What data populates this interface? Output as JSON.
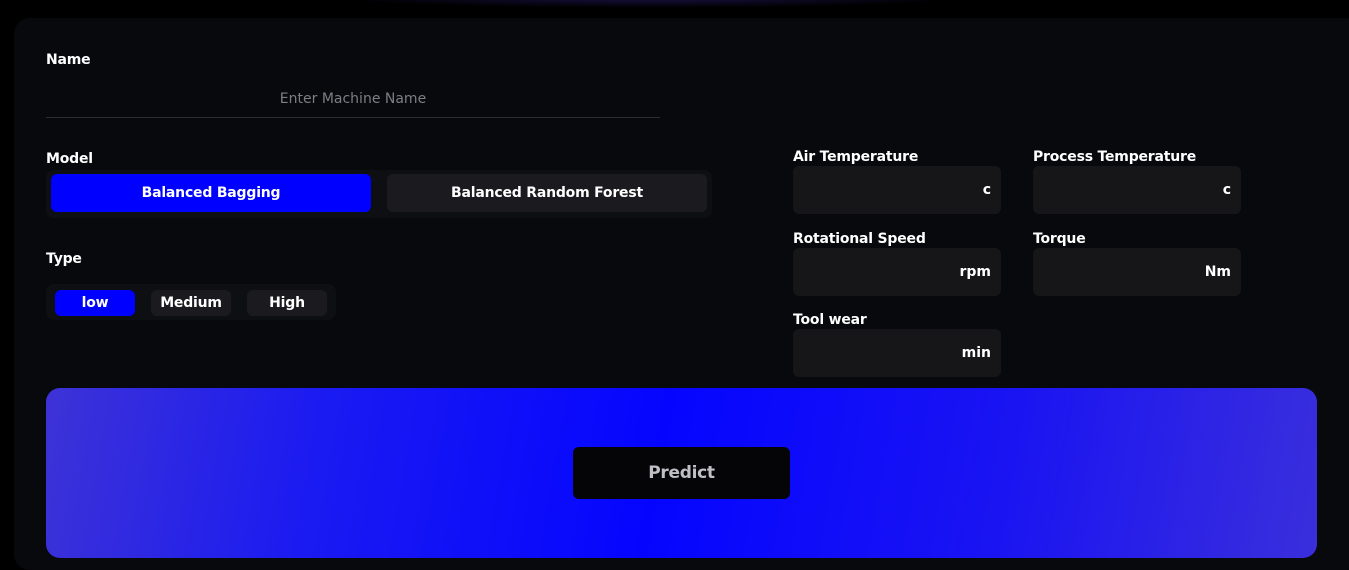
{
  "form": {
    "name": {
      "label": "Name",
      "placeholder": "Enter Machine Name",
      "value": ""
    },
    "model": {
      "label": "Model",
      "options": [
        "Balanced Bagging",
        "Balanced Random Forest"
      ],
      "selected": "Balanced Bagging"
    },
    "type": {
      "label": "Type",
      "options": [
        "low",
        "Medium",
        "High"
      ],
      "selected": "low"
    },
    "inputs": {
      "air_temperature": {
        "label": "Air Temperature",
        "unit": "c",
        "value": ""
      },
      "process_temperature": {
        "label": "Process Temperature",
        "unit": "c",
        "value": ""
      },
      "rotational_speed": {
        "label": "Rotational Speed",
        "unit": "rpm",
        "value": ""
      },
      "torque": {
        "label": "Torque",
        "unit": "Nm",
        "value": ""
      },
      "tool_wear": {
        "label": "Tool wear",
        "unit": "min",
        "value": ""
      }
    },
    "predict_label": "Predict"
  },
  "colors": {
    "accent": "#0000ff",
    "card_bg": "#07090d",
    "button_bg": "#1b1b1f",
    "field_bg": "#161618"
  }
}
